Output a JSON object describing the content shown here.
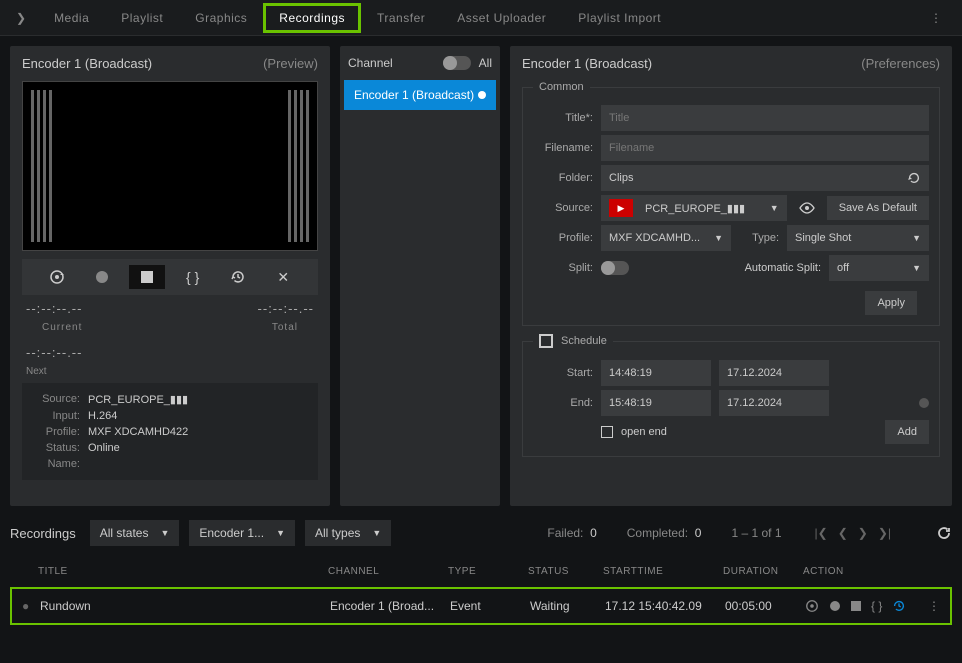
{
  "tabs": [
    "Media",
    "Playlist",
    "Graphics",
    "Recordings",
    "Transfer",
    "Asset Uploader",
    "Playlist Import"
  ],
  "active_tab": "Recordings",
  "left": {
    "title": "Encoder 1 (Broadcast)",
    "sub": "(Preview)",
    "tc_top_left": "--:--:--.--",
    "tc_top_right": "--:--:--.--",
    "lbl_current": "Current",
    "lbl_total": "Total",
    "tc_mid": "--:--:--.--",
    "lbl_next": "Next",
    "info": {
      "source_k": "Source:",
      "source_v": "PCR_EUROPE_▮▮▮",
      "input_k": "Input:",
      "input_v": "H.264",
      "profile_k": "Profile:",
      "profile_v": "MXF XDCAMHD422",
      "status_k": "Status:",
      "status_v": "Online",
      "name_k": "Name:",
      "name_v": ""
    }
  },
  "mid": {
    "title": "Channel",
    "all": "All",
    "item": "Encoder 1 (Broadcast)"
  },
  "right": {
    "title": "Encoder 1 (Broadcast)",
    "sub": "(Preferences)",
    "common": {
      "legend": "Common",
      "title_lbl": "Title*:",
      "title_ph": "Title",
      "file_lbl": "Filename:",
      "file_ph": "Filename",
      "folder_lbl": "Folder:",
      "folder_v": "Clips",
      "source_lbl": "Source:",
      "source_v": "PCR_EUROPE_▮▮▮",
      "save_default": "Save As Default",
      "profile_lbl": "Profile:",
      "profile_v": "MXF XDCAMHD...",
      "type_lbl": "Type:",
      "type_v": "Single Shot",
      "split_lbl": "Split:",
      "auto_split_lbl": "Automatic Split:",
      "auto_split_v": "off",
      "apply": "Apply"
    },
    "schedule": {
      "legend": "Schedule",
      "start_lbl": "Start:",
      "start_time": "14:48:19",
      "start_date": "17.12.2024",
      "end_lbl": "End:",
      "end_time": "15:48:19",
      "end_date": "17.12.2024",
      "open_end": "open end",
      "add": "Add"
    }
  },
  "bottom": {
    "title": "Recordings",
    "f_state": "All states",
    "f_enc": "Encoder 1...",
    "f_type": "All types",
    "failed_lbl": "Failed:",
    "failed_n": "0",
    "completed_lbl": "Completed:",
    "completed_n": "0",
    "page": "1 – 1 of 1",
    "cols": {
      "title": "TITLE",
      "channel": "CHANNEL",
      "type": "TYPE",
      "status": "STATUS",
      "start": "STARTTIME",
      "dur": "DURATION",
      "action": "ACTION"
    },
    "row": {
      "title": "Rundown",
      "channel": "Encoder 1 (Broad...",
      "type": "Event",
      "status": "Waiting",
      "start": "17.12 15:40:42.09",
      "dur": "00:05:00"
    }
  }
}
